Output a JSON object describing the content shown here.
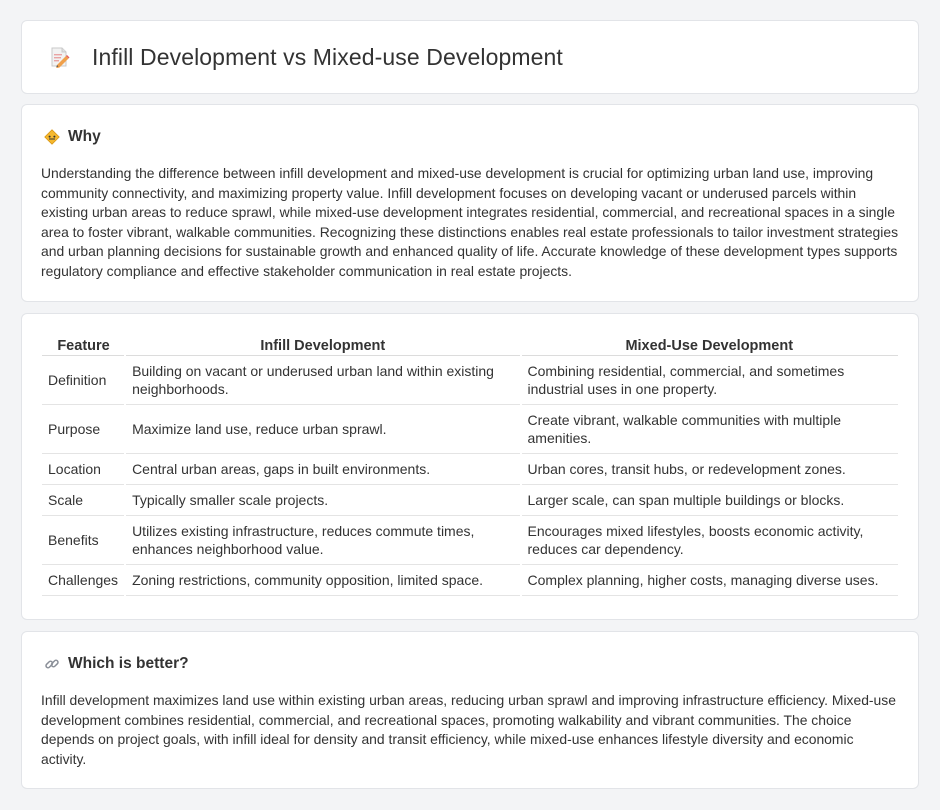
{
  "header": {
    "title": "Infill Development vs Mixed-use Development",
    "icon": "document-pencil-icon"
  },
  "why": {
    "icon": "diamond-sign-icon",
    "title": "Why",
    "body": "Understanding the difference between infill development and mixed-use development is crucial for optimizing urban land use, improving community connectivity, and maximizing property value. Infill development focuses on developing vacant or underused parcels within existing urban areas to reduce sprawl, while mixed-use development integrates residential, commercial, and recreational spaces in a single area to foster vibrant, walkable communities. Recognizing these distinctions enables real estate professionals to tailor investment strategies and urban planning decisions for sustainable growth and enhanced quality of life. Accurate knowledge of these development types supports regulatory compliance and effective stakeholder communication in real estate projects."
  },
  "table": {
    "headers": [
      "Feature",
      "Infill Development",
      "Mixed-Use Development"
    ],
    "rows": [
      [
        "Definition",
        "Building on vacant or underused urban land within existing neighborhoods.",
        "Combining residential, commercial, and sometimes industrial uses in one property."
      ],
      [
        "Purpose",
        "Maximize land use, reduce urban sprawl.",
        "Create vibrant, walkable communities with multiple amenities."
      ],
      [
        "Location",
        "Central urban areas, gaps in built environments.",
        "Urban cores, transit hubs, or redevelopment zones."
      ],
      [
        "Scale",
        "Typically smaller scale projects.",
        "Larger scale, can span multiple buildings or blocks."
      ],
      [
        "Benefits",
        "Utilizes existing infrastructure, reduces commute times, enhances neighborhood value.",
        "Encourages mixed lifestyles, boosts economic activity, reduces car dependency."
      ],
      [
        "Challenges",
        "Zoning restrictions, community opposition, limited space.",
        "Complex planning, higher costs, managing diverse uses."
      ]
    ]
  },
  "better": {
    "icon": "link-icon",
    "title": "Which is better?",
    "body": "Infill development maximizes land use within existing urban areas, reducing urban sprawl and improving infrastructure efficiency. Mixed-use development combines residential, commercial, and recreational spaces, promoting walkability and vibrant communities. The choice depends on project goals, with infill ideal for density and transit efficiency, while mixed-use enhances lifestyle diversity and economic activity."
  }
}
